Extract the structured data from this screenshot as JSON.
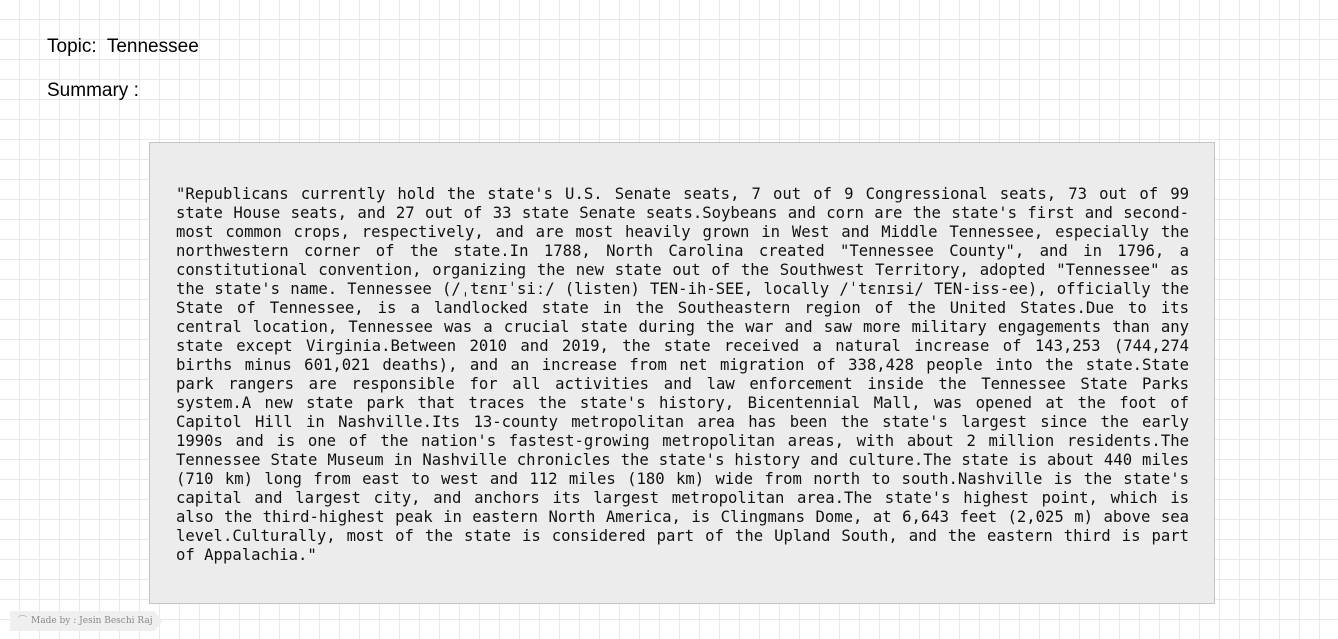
{
  "topic": {
    "label": "Topic:",
    "value": "Tennessee"
  },
  "summary": {
    "label": "Summary :",
    "text": "\"Republicans currently hold the state's U.S. Senate seats, 7 out of 9 Congressional seats, 73 out of 99 state House seats, and 27 out of 33 state Senate seats.Soybeans and corn are the state's first and second-most common crops, respectively, and are most heavily grown in West and Middle Tennessee, especially the northwestern corner of the state.In 1788, North Carolina created \"Tennessee County\", and in 1796, a constitutional convention, organizing the new state out of the Southwest Territory, adopted \"Tennessee\" as the state's name. Tennessee (/ˌtɛnɪˈsiː/ (listen) TEN-ih-SEE, locally /ˈtɛnɪsi/ TEN-iss-ee), officially the State of Tennessee, is a landlocked state in the Southeastern region of the United States.Due to its central location, Tennessee was a crucial state during the war and saw more military engagements than any state except Virginia.Between 2010 and 2019, the state received a natural increase of 143,253 (744,274 births minus 601,021 deaths), and an increase from net migration of 338,428 people into the state.State park rangers are responsible for all activities and law enforcement inside the Tennessee State Parks system.A new state park that traces the state's history, Bicentennial Mall, was opened at the foot of Capitol Hill in Nashville.Its 13-county metropolitan area has been the state's largest since the early 1990s and is one of the nation's fastest-growing metropolitan areas, with about 2 million residents.The Tennessee State Museum in Nashville chronicles the state's history and culture.The state is about 440 miles (710 km) long from east to west and 112 miles (180 km) wide from north to south.Nashville is the state's capital and largest city, and anchors its largest metropolitan area.The state's highest point, which is also the third-highest peak in eastern North America, is Clingmans Dome, at 6,643 feet (2,025 m) above sea level.Culturally, most of the state is considered part of the Upland South, and the eastern third is part of Appalachia.\""
  },
  "footer": {
    "credit": "Made by : Jesin Beschi Raj",
    "credit_icon": "tag-icon"
  },
  "colors": {
    "background": "#ffffff",
    "grid": "#e9e9e9",
    "summary_box": "#ececec",
    "summary_border": "#c4c4c4"
  }
}
